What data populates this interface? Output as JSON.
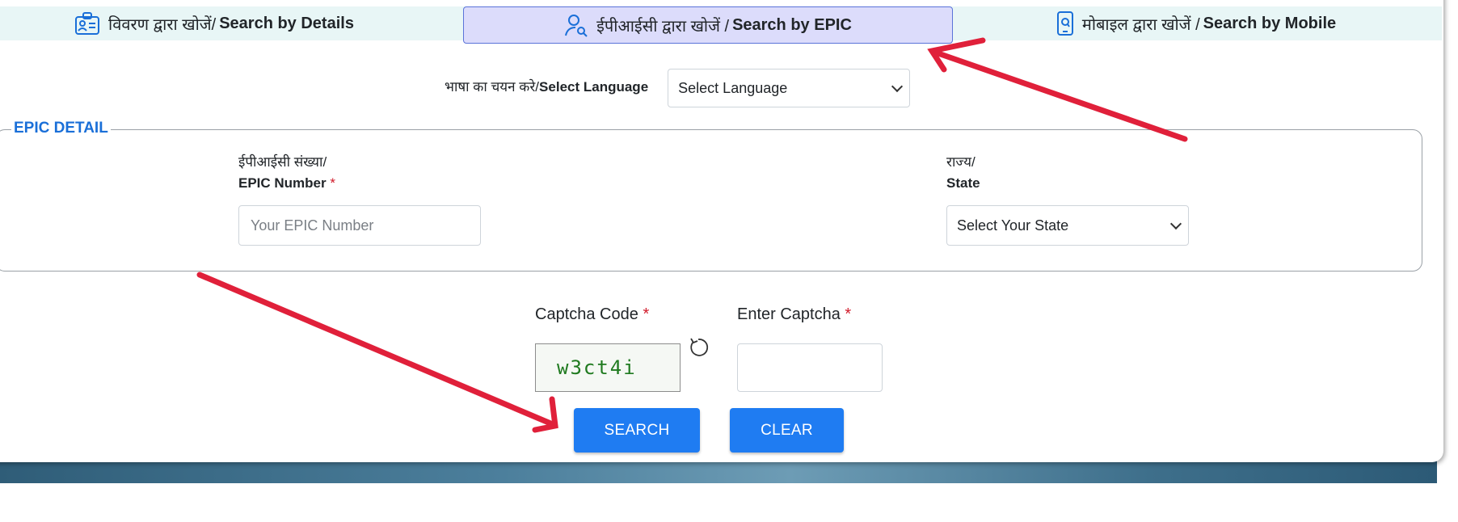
{
  "tabs": [
    {
      "hindi": "विवरण द्वारा खोजें/",
      "english": "Search by Details",
      "icon": "id-card-icon"
    },
    {
      "hindi": "ईपीआईसी द्वारा खोजें /",
      "english": "Search by EPIC",
      "icon": "user-search-icon"
    },
    {
      "hindi": "मोबाइल द्वारा खोजें /",
      "english": "Search by Mobile",
      "icon": "mobile-search-icon"
    }
  ],
  "language": {
    "label_hindi": "भाषा का चयन करे/",
    "label_english": "Select Language",
    "selected": "Select Language"
  },
  "epic_detail": {
    "legend": "EPIC DETAIL",
    "epic_label_hindi": "ईपीआईसी संख्या/",
    "epic_label_english": "EPIC Number",
    "epic_placeholder": "Your EPIC Number",
    "state_label_hindi": "राज्य/",
    "state_label_english": "State",
    "state_selected": "Select Your State",
    "required_mark": "*"
  },
  "captcha": {
    "code_label": "Captcha Code",
    "code_value": "w3ct4i",
    "enter_label": "Enter Captcha",
    "required_mark": "*",
    "refresh_icon": "refresh-icon"
  },
  "buttons": {
    "search": "SEARCH",
    "clear": "CLEAR"
  },
  "colors": {
    "primary_button": "#1f7cf2",
    "legend_blue": "#1a6fd8",
    "active_tab_bg": "#dcdcfb",
    "tab_strip_bg": "#e8f6f6",
    "annotation_arrow": "#e0203a",
    "captcha_text": "#1f7a1f",
    "required": "#d11a2a"
  }
}
